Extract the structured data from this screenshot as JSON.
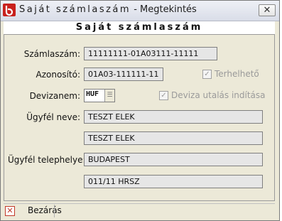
{
  "window": {
    "title_spaced": "Saját számlaszám",
    "title_suffix": " - Megtekintés",
    "close_glyph": "✕"
  },
  "header": {
    "title": "Saját számlaszám"
  },
  "form": {
    "account_number": {
      "label": "Számlaszám:",
      "value": "11111111-01A03111-11111"
    },
    "identifier": {
      "label": "Azonosító:",
      "value": "01A03-111111-11"
    },
    "chargeable": {
      "label": "Terhelhető",
      "checked": true,
      "enabled": false
    },
    "currency": {
      "label": "Devizanem:",
      "value": "HUF"
    },
    "fx_transfer": {
      "label": "Deviza utalás indítása",
      "checked": true,
      "enabled": false
    },
    "client_name": {
      "label": "Ügyfél neve:",
      "line1": "TESZT ELEK",
      "line2": "TESZT ELEK"
    },
    "client_site": {
      "label": "Ügyfél telephelye:",
      "line1": "BUDAPEST",
      "line2": "011/11 HRSZ"
    }
  },
  "footer": {
    "close_label": "Bezárás",
    "close_icon_glyph": "✕"
  },
  "colors": {
    "window_bg": "#ece9d8",
    "field_bg": "#e6e6e6",
    "close_icon_red": "#c23a2a",
    "disabled_text": "#9a9a9a"
  }
}
